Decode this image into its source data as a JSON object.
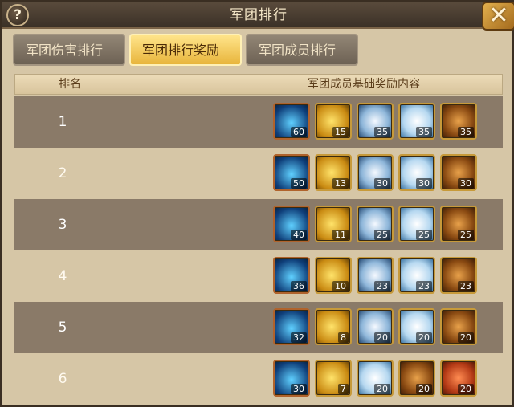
{
  "window": {
    "title": "军团排行",
    "help_label": "?",
    "close_label": "✕"
  },
  "tabs": [
    {
      "label": "军团伤害排行",
      "active": false
    },
    {
      "label": "军团排行奖励",
      "active": true
    },
    {
      "label": "军团成员排行",
      "active": false
    }
  ],
  "table": {
    "headers": {
      "rank": "排名",
      "content": "军团成员基础奖励内容"
    },
    "rows": [
      {
        "rank": "1",
        "rewards": [
          {
            "icon": "potion-icon",
            "count": "60"
          },
          {
            "icon": "crystal-icon",
            "count": "15"
          },
          {
            "icon": "white-gem-icon",
            "count": "35"
          },
          {
            "icon": "feather-icon",
            "count": "35"
          },
          {
            "icon": "seeds-icon",
            "count": "35"
          }
        ]
      },
      {
        "rank": "2",
        "rewards": [
          {
            "icon": "potion-icon",
            "count": "50"
          },
          {
            "icon": "crystal-icon",
            "count": "13"
          },
          {
            "icon": "white-gem-icon",
            "count": "30"
          },
          {
            "icon": "feather-icon",
            "count": "30"
          },
          {
            "icon": "seeds-icon",
            "count": "30"
          }
        ]
      },
      {
        "rank": "3",
        "rewards": [
          {
            "icon": "potion-icon",
            "count": "40"
          },
          {
            "icon": "crystal-icon",
            "count": "11"
          },
          {
            "icon": "white-gem-icon",
            "count": "25"
          },
          {
            "icon": "feather-icon",
            "count": "25"
          },
          {
            "icon": "seeds-icon",
            "count": "25"
          }
        ]
      },
      {
        "rank": "4",
        "rewards": [
          {
            "icon": "potion-icon",
            "count": "36"
          },
          {
            "icon": "crystal-icon",
            "count": "10"
          },
          {
            "icon": "white-gem-icon",
            "count": "23"
          },
          {
            "icon": "feather-icon",
            "count": "23"
          },
          {
            "icon": "seeds-icon",
            "count": "23"
          }
        ]
      },
      {
        "rank": "5",
        "rewards": [
          {
            "icon": "potion-icon",
            "count": "32"
          },
          {
            "icon": "crystal-icon",
            "count": "8"
          },
          {
            "icon": "white-gem-icon",
            "count": "20"
          },
          {
            "icon": "feather-icon",
            "count": "20"
          },
          {
            "icon": "seeds-icon",
            "count": "20"
          }
        ]
      },
      {
        "rank": "6",
        "rewards": [
          {
            "icon": "potion-icon",
            "count": "30"
          },
          {
            "icon": "crystal-icon",
            "count": "7"
          },
          {
            "icon": "feather-icon",
            "count": "20"
          },
          {
            "icon": "seeds-icon",
            "count": "20"
          },
          {
            "icon": "chest-icon",
            "count": "20"
          }
        ]
      }
    ]
  }
}
